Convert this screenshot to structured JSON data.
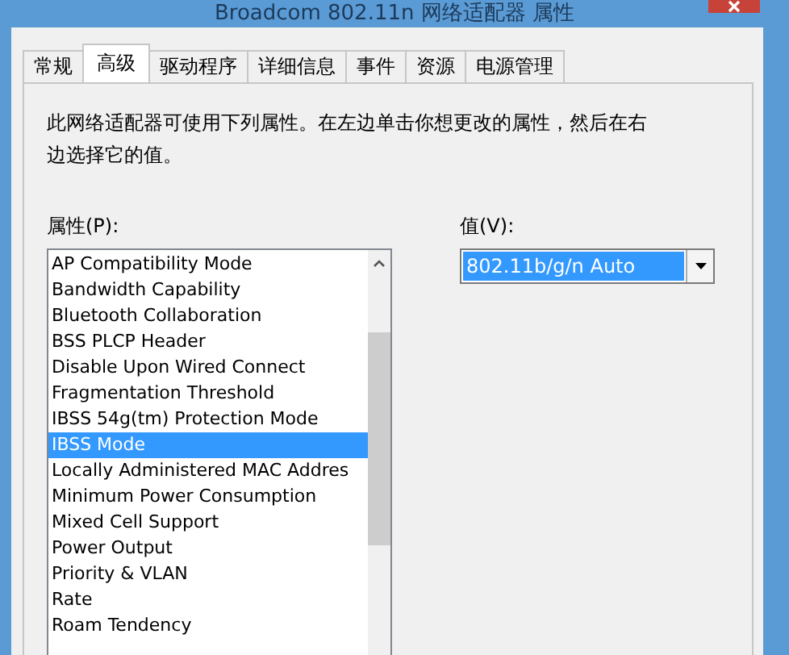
{
  "window": {
    "title": "Broadcom 802.11n 网络适配器 属性"
  },
  "tabs": [
    {
      "label": "常规",
      "selected": false
    },
    {
      "label": "高级",
      "selected": true
    },
    {
      "label": "驱动程序",
      "selected": false
    },
    {
      "label": "详细信息",
      "selected": false
    },
    {
      "label": "事件",
      "selected": false
    },
    {
      "label": "资源",
      "selected": false
    },
    {
      "label": "电源管理",
      "selected": false
    }
  ],
  "description": "此网络适配器可使用下列属性。在左边单击你想更改的属性，然后在右边选择它的值。",
  "property_label": "属性(P):",
  "properties": [
    {
      "label": "AP Compatibility Mode",
      "selected": false
    },
    {
      "label": "Bandwidth Capability",
      "selected": false
    },
    {
      "label": "Bluetooth Collaboration",
      "selected": false
    },
    {
      "label": "BSS PLCP Header",
      "selected": false
    },
    {
      "label": "Disable Upon Wired Connect",
      "selected": false
    },
    {
      "label": "Fragmentation Threshold",
      "selected": false
    },
    {
      "label": "IBSS 54g(tm) Protection Mode",
      "selected": false
    },
    {
      "label": "IBSS Mode",
      "selected": true
    },
    {
      "label": "Locally Administered MAC Addres",
      "selected": false
    },
    {
      "label": "Minimum Power Consumption",
      "selected": false
    },
    {
      "label": "Mixed Cell Support",
      "selected": false
    },
    {
      "label": "Power Output",
      "selected": false
    },
    {
      "label": "Priority & VLAN",
      "selected": false
    },
    {
      "label": "Rate",
      "selected": false
    },
    {
      "label": "Roam Tendency",
      "selected": false
    }
  ],
  "value_label": "值(V):",
  "value": "802.11b/g/n Auto"
}
